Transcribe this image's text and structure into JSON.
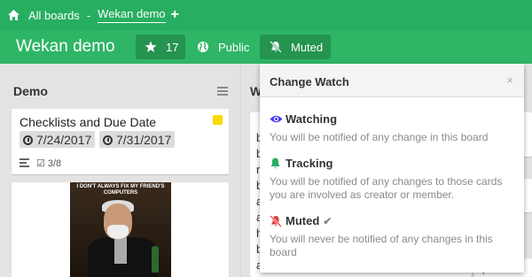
{
  "header": {
    "home_icon": "home-icon",
    "all_boards": "All boards",
    "separator": "-",
    "current_board": "Wekan demo",
    "add_icon": "+"
  },
  "board": {
    "title": "Wekan demo",
    "stars": "17",
    "visibility": "Public",
    "watch_status": "Muted"
  },
  "lists": [
    {
      "title": "Demo",
      "cards": [
        {
          "title": "Checklists and Due Date",
          "start_date": "7/24/2017",
          "due_date": "7/31/2017",
          "checklist": "3/8",
          "label_color": "#fad900"
        },
        {
          "meme_text": "I DON'T ALWAYS FIX MY FRIEND'S COMPUTERS"
        }
      ]
    },
    {
      "title": "W",
      "visible_glyphs": [
        "C",
        "b",
        "b",
        "r",
        "b",
        "a",
        "a",
        "h",
        "b",
        "a",
        "c",
        "e",
        "T"
      ]
    },
    {
      "glyphs": [
        "e",
        "s.",
        "eq",
        "ps"
      ]
    }
  ],
  "popup": {
    "title": "Change Watch",
    "close": "×",
    "options": [
      {
        "name": "Watching",
        "desc": "You will be notified of any change in this board",
        "icon": "eye-icon",
        "color": "#4a3aff"
      },
      {
        "name": "Tracking",
        "desc": "You will be notified of any changes to those cards you are involved as creator or member.",
        "icon": "bell-icon",
        "color": "#27ae60"
      },
      {
        "name": "Muted",
        "desc": "You will never be notified of any changes in this board",
        "icon": "bell-slash-icon",
        "color": "#e03a3a",
        "selected": "✔"
      }
    ]
  },
  "colors": {
    "topbar": "#27ae60",
    "boardbar": "#2fb566"
  }
}
